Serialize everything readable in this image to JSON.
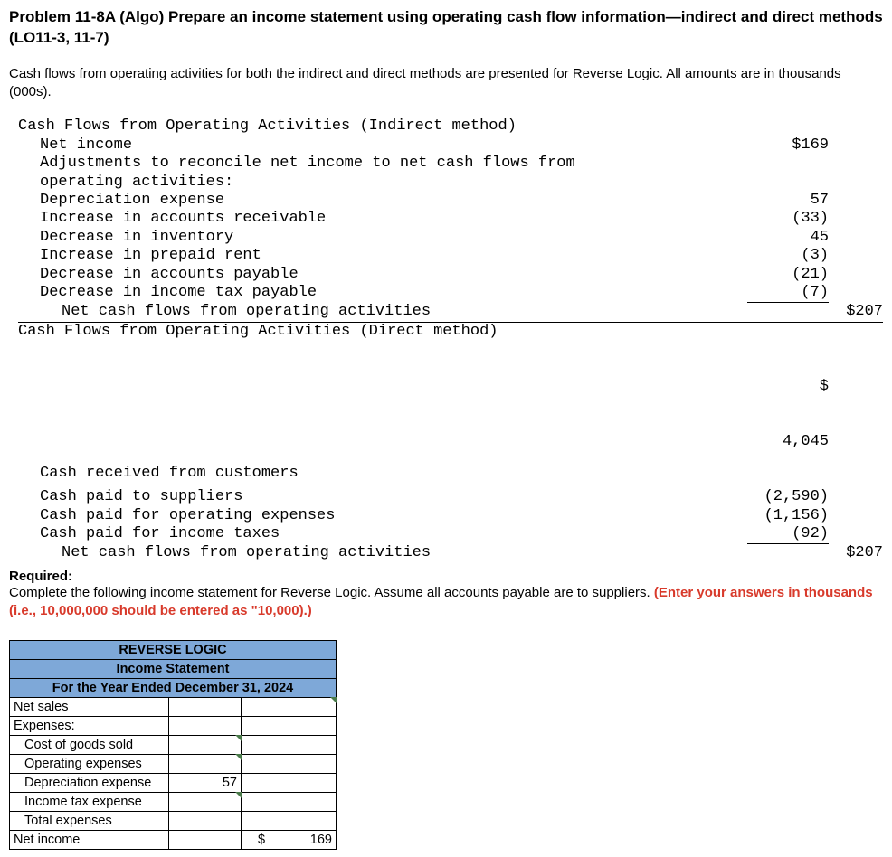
{
  "title": "Problem 11-8A (Algo) Prepare an income statement using operating cash flow information—indirect and direct methods (LO11-3, 11-7)",
  "intro": "Cash flows from operating activities for both the indirect and direct methods are presented for Reverse Logic. All amounts are in thousands (000s).",
  "indirect": {
    "heading": "Cash Flows from Operating Activities (Indirect method)",
    "net_income_label": "Net income",
    "net_income_value": "$169",
    "adjust_label": "Adjustments to reconcile net income to net cash flows from operating activities:",
    "rows": [
      {
        "label": "Depreciation expense",
        "v1": "57"
      },
      {
        "label": "Increase in accounts receivable",
        "v1": "(33)"
      },
      {
        "label": "Decrease in inventory",
        "v1": "45"
      },
      {
        "label": "Increase in prepaid rent",
        "v1": "(3)"
      },
      {
        "label": "Decrease in accounts payable",
        "v1": "(21)"
      },
      {
        "label": "Decrease in income tax payable",
        "v1": "(7)"
      }
    ],
    "total_label": "Net cash flows from operating activities",
    "total_value": "$207"
  },
  "direct": {
    "heading": "Cash Flows from Operating Activities (Direct method)",
    "cash_received_label": "Cash received from customers",
    "cash_received_sym": "$",
    "cash_received_val": "4,045",
    "rows": [
      {
        "label": "Cash paid to suppliers",
        "v1": "(2,590)"
      },
      {
        "label": "Cash paid for operating expenses",
        "v1": "(1,156)"
      },
      {
        "label": "Cash paid for income taxes",
        "v1": "(92)"
      }
    ],
    "total_label": "Net cash flows from operating activities",
    "total_value": "$207"
  },
  "required": {
    "label": "Required:",
    "text_black": "Complete the following income statement for Reverse Logic. Assume all accounts payable are to suppliers. ",
    "text_red": "(Enter your answers in thousands (i.e., 10,000,000 should be entered as \"10,000).)"
  },
  "answer": {
    "company": "REVERSE LOGIC",
    "stmt": "Income Statement",
    "period": "For the Year Ended December 31, 2024",
    "rows": {
      "net_sales": "Net sales",
      "expenses": "Expenses:",
      "cogs": "Cost of goods sold",
      "opex": "Operating expenses",
      "dep": "Depreciation expense",
      "dep_val": "57",
      "tax": "Income tax expense",
      "total_exp": "Total expenses",
      "net_income": "Net income",
      "ni_sym": "$",
      "ni_val": "169"
    }
  }
}
